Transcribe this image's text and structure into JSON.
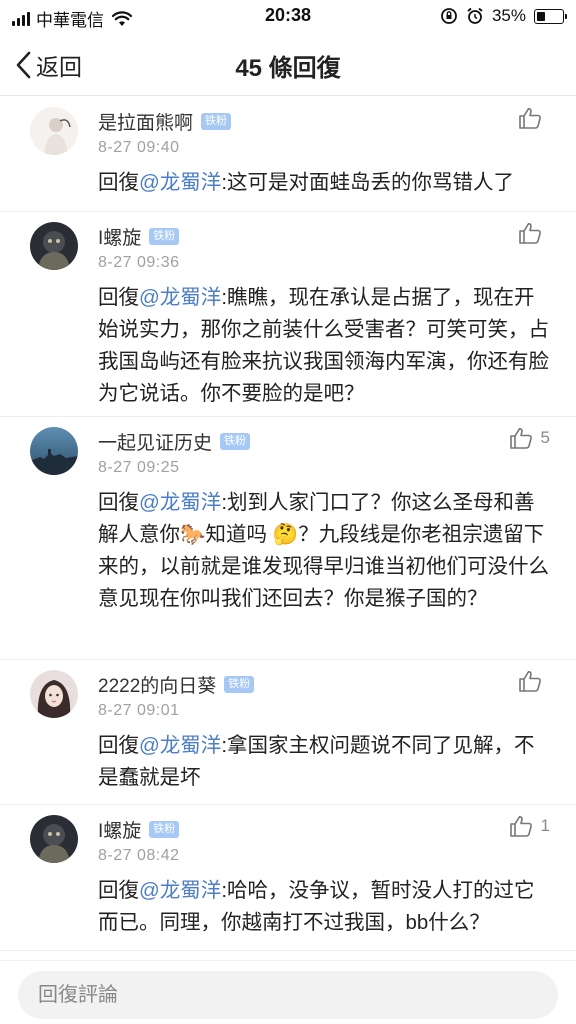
{
  "status_bar": {
    "carrier": "中華電信",
    "time": "20:38",
    "battery": "35%",
    "battery_level": 0.35
  },
  "nav": {
    "back_label": "返回",
    "title": "45 條回復"
  },
  "replies": [
    {
      "username": "是拉面熊啊",
      "badge": "铁粉",
      "time": "8-27 09:40",
      "prefix": "回復",
      "mention": "@龙蜀洋",
      "text": ":这可是对面蛙岛丢的你骂错人了",
      "likes": ""
    },
    {
      "username": "I螺旋",
      "badge": "铁粉",
      "time": "8-27 09:36",
      "prefix": "回復",
      "mention": "@龙蜀洋",
      "text": ":瞧瞧，现在承认是占据了，现在开始说实力，那你之前装什么受害者？可笑可笑，占我国岛屿还有脸来抗议我国领海内军演，你还有脸为它说话。你不要脸的是吧？",
      "likes": ""
    },
    {
      "username": "一起见证历史",
      "badge": "铁粉",
      "time": "8-27 09:25",
      "prefix": "回復",
      "mention": "@龙蜀洋",
      "text": ":划到人家门口了？你这么圣母和善解人意你🐎知道吗 🤔？九段线是你老祖宗遗留下来的，以前就是谁发现得早归谁当初他们可没什么意见现在你叫我们还回去？你是猴子国的？",
      "likes": "5"
    },
    {
      "username": "2222的向日葵",
      "badge": "铁粉",
      "time": "8-27 09:01",
      "prefix": "回復",
      "mention": "@龙蜀洋",
      "text": ":拿国家主权问题说不同了见解，不是蠢就是坏",
      "likes": ""
    },
    {
      "username": "I螺旋",
      "badge": "铁粉",
      "time": "8-27 08:42",
      "prefix": "回復",
      "mention": "@龙蜀洋",
      "text": ":哈哈，没争议，暂时没人打的过它而已。同理，你越南打不过我国，bb什么？",
      "likes": "1"
    }
  ],
  "bottom": {
    "placeholder": "回復評論"
  },
  "icons": {
    "back": "chevron-left-icon",
    "like": "thumbs-up-icon",
    "wifi": "wifi-icon",
    "lock": "orientation-lock-icon",
    "alarm": "alarm-icon"
  },
  "colors": {
    "mention": "#4d7ec9",
    "badge": "#a6c8f5",
    "meta": "#a0a0a0"
  }
}
